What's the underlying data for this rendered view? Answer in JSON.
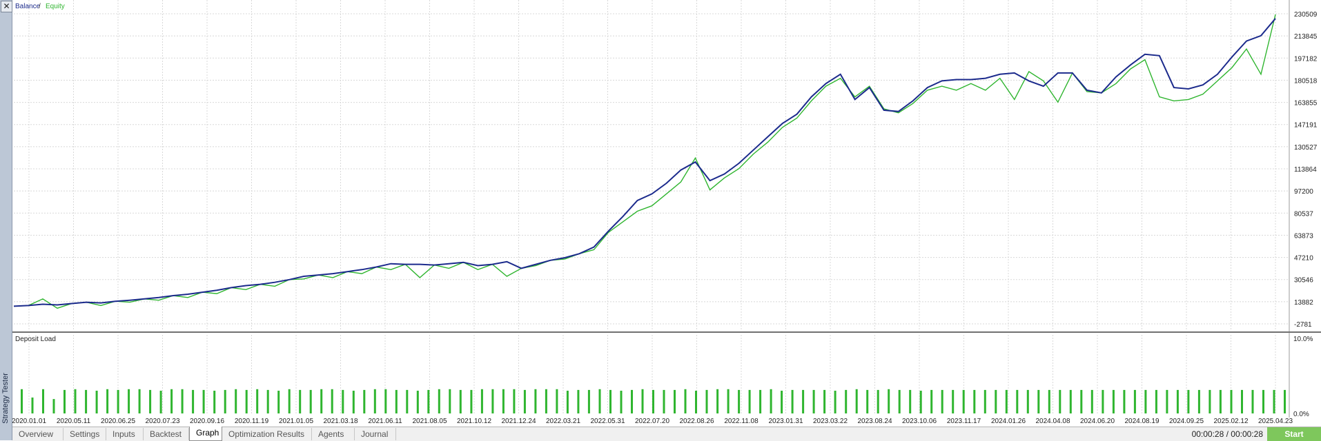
{
  "sidebar": {
    "title": "Strategy Tester",
    "close_glyph": "✕"
  },
  "legend": {
    "balance": "Balance",
    "separator": " / ",
    "equity": "Equity"
  },
  "deposit_panel": {
    "title": "Deposit Load",
    "max_label": "10.0%",
    "min_label": "0.0%"
  },
  "colors": {
    "balance": "#1b2a8c",
    "equity": "#2fb52f",
    "bars": "#2fb52f",
    "grid": "#d8d8d8",
    "divider": "#707070"
  },
  "chart_data": [
    {
      "type": "line",
      "title": "",
      "legend": [
        "Balance",
        "Equity"
      ],
      "y_ticks": [
        "230509",
        "213845",
        "197182",
        "180518",
        "163855",
        "147191",
        "130527",
        "113864",
        "97200",
        "80537",
        "63873",
        "47210",
        "30546",
        "13882",
        "-2781"
      ],
      "ylim": [
        -2781,
        230509
      ],
      "x_ticks": [
        "2020.01.01",
        "2020.05.11",
        "2020.06.25",
        "2020.07.23",
        "2020.09.16",
        "2020.11.19",
        "2021.01.05",
        "2021.03.18",
        "2021.06.11",
        "2021.08.05",
        "2021.10.12",
        "2021.12.24",
        "2022.03.21",
        "2022.05.31",
        "2022.07.20",
        "2022.08.26",
        "2022.11.08",
        "2023.01.31",
        "2023.03.22",
        "2023.08.24",
        "2023.10.06",
        "2023.11.17",
        "2024.01.26",
        "2024.04.08",
        "2024.06.20",
        "2024.08.19",
        "2024.09.25",
        "2025.02.12",
        "2025.04.23"
      ],
      "series": [
        {
          "name": "Balance",
          "values": [
            10500,
            11000,
            12000,
            11500,
            12500,
            13500,
            13000,
            14200,
            15000,
            16000,
            17000,
            18500,
            19500,
            21000,
            22500,
            24500,
            26000,
            27000,
            28500,
            30500,
            33000,
            34000,
            35000,
            36500,
            38000,
            40000,
            42500,
            42000,
            42000,
            41500,
            42500,
            43500,
            41000,
            42000,
            44000,
            39000,
            42000,
            45000,
            47000,
            50000,
            55000,
            67000,
            78000,
            90000,
            95000,
            103000,
            113000,
            119000,
            105000,
            110000,
            118000,
            128000,
            138000,
            148000,
            155000,
            168000,
            178000,
            185000,
            166000,
            175000,
            158000,
            157000,
            165000,
            175000,
            180000,
            181000,
            181000,
            182000,
            185000,
            186000,
            180000,
            176000,
            186000,
            186000,
            173000,
            171000,
            183000,
            192000,
            200000,
            199000,
            175000,
            174000,
            177000,
            185000,
            198000,
            210000,
            214000,
            227000
          ]
        },
        {
          "name": "Equity",
          "values": [
            10500,
            11000,
            16000,
            9000,
            12500,
            13500,
            11000,
            14200,
            13500,
            16000,
            15000,
            18500,
            17000,
            21000,
            20000,
            24500,
            23000,
            27000,
            25500,
            30500,
            31000,
            34000,
            32000,
            36500,
            35000,
            40000,
            38000,
            42000,
            32000,
            41500,
            39000,
            43500,
            38000,
            42000,
            33000,
            39000,
            41000,
            45000,
            46000,
            50000,
            53000,
            66000,
            74000,
            82000,
            86000,
            95000,
            104000,
            122000,
            98000,
            107000,
            114000,
            125000,
            134000,
            145000,
            152000,
            165000,
            176000,
            182000,
            168000,
            176000,
            159000,
            156000,
            163000,
            173000,
            176000,
            173000,
            178000,
            173000,
            182000,
            166000,
            187000,
            180000,
            164000,
            186000,
            172000,
            171000,
            178000,
            189000,
            196000,
            168000,
            165000,
            166000,
            170000,
            180000,
            190000,
            204000,
            185000,
            230000
          ]
        }
      ]
    },
    {
      "type": "bar",
      "title": "Deposit Load",
      "ylim": [
        0,
        10
      ],
      "y_ticks": [
        "10.0%",
        "0.0%"
      ],
      "values": [
        3.2,
        2.1,
        3.2,
        1.9,
        3.1,
        3.2,
        3.1,
        3.0,
        3.2,
        3.1,
        3.2,
        3.2,
        3.1,
        3.0,
        3.2,
        3.2,
        3.1,
        3.1,
        3.0,
        3.1,
        3.2,
        3.1,
        3.2,
        3.1,
        3.0,
        3.2,
        3.1,
        3.1,
        3.2,
        3.2,
        3.1,
        3.0,
        3.1,
        3.2,
        3.2,
        3.1,
        3.1,
        3.0,
        3.1,
        3.2,
        3.2,
        3.1,
        3.1,
        3.2,
        3.2,
        3.2,
        3.2,
        3.1,
        3.2,
        3.2,
        3.2,
        3.0,
        3.1,
        3.1,
        3.2,
        3.1,
        3.0,
        3.1,
        3.2,
        3.1,
        3.1,
        3.1,
        3.2,
        3.0,
        3.1,
        3.2,
        3.2,
        3.1,
        3.1,
        3.1,
        3.2,
        3.0,
        3.1,
        3.1,
        3.1,
        3.1,
        3.0,
        3.1,
        3.2,
        3.1,
        3.1,
        3.2,
        3.1,
        3.1,
        3.0,
        3.1,
        3.1,
        3.1,
        3.1,
        3.1,
        3.1,
        3.1,
        3.1,
        3.1,
        3.1,
        3.1,
        3.1,
        3.1,
        3.1,
        3.1,
        3.1,
        3.1,
        3.1,
        3.1,
        3.1,
        3.1,
        3.1,
        3.1,
        3.1,
        3.1,
        3.1,
        3.1,
        3.1,
        3.1,
        3.1,
        3.1,
        3.1,
        3.1,
        3.1
      ]
    }
  ],
  "tabs": [
    {
      "label": "Overview",
      "active": false
    },
    {
      "label": "Settings",
      "active": false
    },
    {
      "label": "Inputs",
      "active": false
    },
    {
      "label": "Backtest",
      "active": false
    },
    {
      "label": "Graph",
      "active": true
    },
    {
      "label": "Optimization Results",
      "active": false
    },
    {
      "label": "Agents",
      "active": false
    },
    {
      "label": "Journal",
      "active": false
    }
  ],
  "status": {
    "timer": "00:00:28 / 00:00:28"
  },
  "start_button": {
    "label": "Start"
  }
}
